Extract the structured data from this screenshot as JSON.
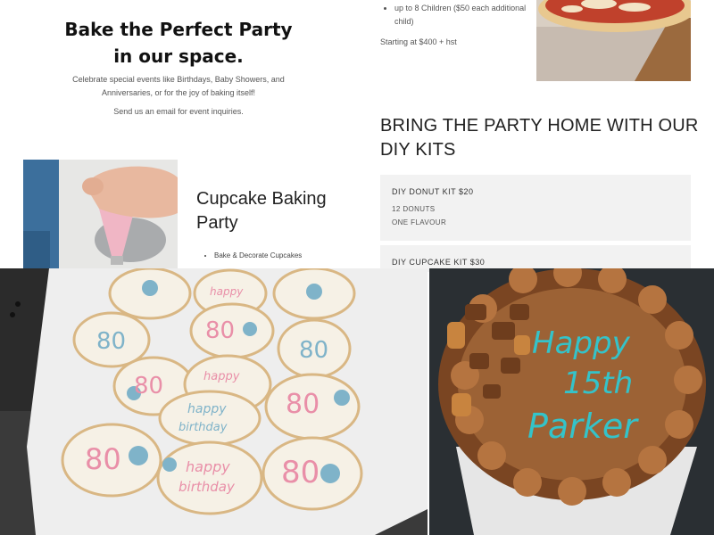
{
  "hero": {
    "title": "Bake the Perfect Party in our space.",
    "description": "Celebrate special events like Birthdays, Baby Showers, and Anniversaries, or for the joy of baking itself!",
    "email_note": "Send us an email for event inquiries."
  },
  "party_details": {
    "bullet": "up to 8 Children ($50 each additional child)",
    "price": "Starting at $400 + hst"
  },
  "diy": {
    "heading": "BRING THE PARTY HOME WITH OUR DIY KITS",
    "kits": [
      {
        "title": "DIY DONUT KIT $20",
        "lines": [
          "12 DONUTS",
          "ONE FLAVOUR"
        ]
      },
      {
        "title": "DIY CUPCAKE KIT $30",
        "lines": []
      }
    ]
  },
  "cupcake_party": {
    "title": "Cupcake Baking Party",
    "bullets": [
      "Bake & Decorate Cupcakes"
    ]
  },
  "cookie_text": {
    "happy": "happy",
    "birthday": "birthday",
    "eighty": "80"
  },
  "cake_text": {
    "line1": "Happy",
    "line2": "15th",
    "line3": "Parker"
  },
  "colors": {
    "card_bg": "#f2f2f2",
    "cookie_icing": "#f6f1e6",
    "cookie_pink": "#e98fa8",
    "cookie_blue": "#7fb3c9",
    "cake_frosting": "#9c6235",
    "cake_teal": "#34c3c9"
  }
}
